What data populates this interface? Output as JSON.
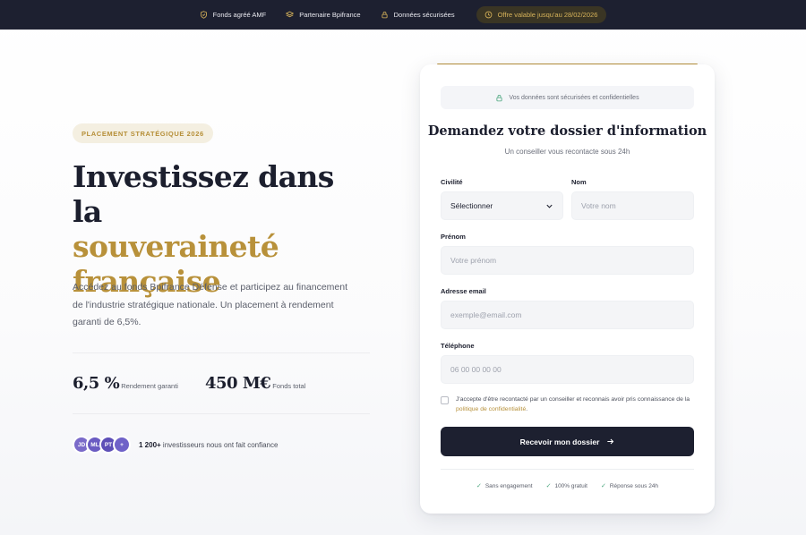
{
  "topbar": {
    "items": [
      "Fonds agréé AMF",
      "Partenaire Bpifrance",
      "Données sécurisées"
    ],
    "offer": "Offre valable jusqu'au 28/02/2026"
  },
  "hero": {
    "badge": "PLACEMENT STRATÉGIQUE 2026",
    "headline_line1": "Investissez dans la",
    "headline_gold1": "souveraineté",
    "headline_gold2": "française",
    "lead": "Accédez au fonds Bpifrance Défense et participez au financement de l'industrie stratégique nationale. Un placement à rendement garanti de 6,5%.",
    "stats": [
      {
        "value": "6,5 %",
        "label": "Rendement garanti"
      },
      {
        "value": "450 M€",
        "label": "Fonds total"
      }
    ],
    "avatars": [
      "JD",
      "ML",
      "PT",
      "+"
    ],
    "investors_count": "1 200+",
    "investors_text": " investisseurs nous ont fait confiance"
  },
  "form": {
    "secure_note": "Vos données sont sécurisées et confidentielles",
    "title": "Demandez votre dossier d'information",
    "subtitle": "Un conseiller vous recontacte sous 24h",
    "civilite_label": "Civilité",
    "civilite_value": "Sélectionner",
    "nom_label": "Nom",
    "nom_placeholder": "Votre nom",
    "prenom_label": "Prénom",
    "prenom_placeholder": "Votre prénom",
    "email_label": "Adresse email",
    "email_placeholder": "exemple@email.com",
    "phone_label": "Téléphone",
    "phone_placeholder": "06 00 00 00 00",
    "consent_text": "J'accepte d'être recontacté par un conseiller et reconnais avoir pris connaissance de la ",
    "consent_link": "politique de confidentialité",
    "consent_end": ".",
    "submit_label": "Recevoir mon dossier",
    "perks": [
      "Sans engagement",
      "100% gratuit",
      "Réponse sous 24h"
    ]
  },
  "colors": {
    "navy": "#1d2030",
    "gold": "#b8913a",
    "avatar_colors": [
      "#7a6ac9",
      "#6a5bc2",
      "#5d4fb7",
      "#6f62c8"
    ]
  }
}
